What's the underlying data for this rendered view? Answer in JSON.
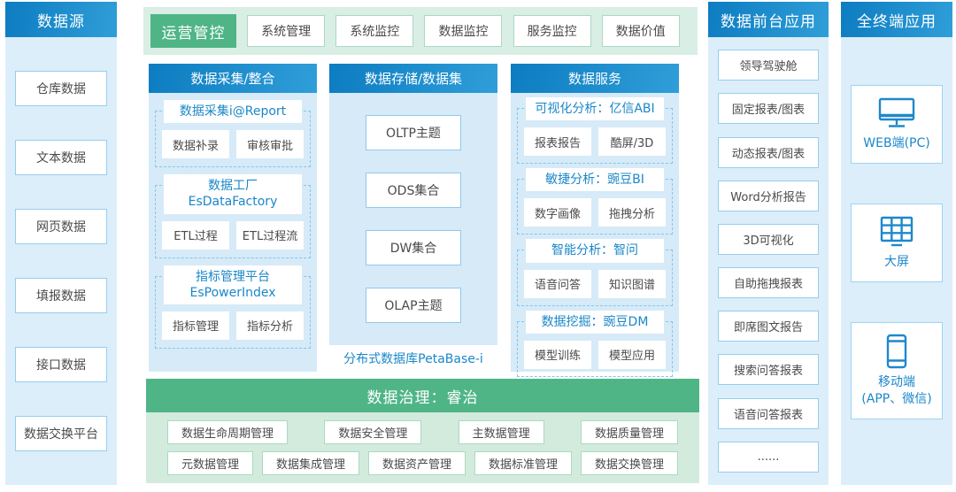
{
  "colors": {
    "header_blue_dark": "#0d7cc1",
    "header_blue_light": "#2f9ed8",
    "panel_blue": "#dceefa",
    "column_blue": "#d6eaf8",
    "box_border_blue": "#94ceef",
    "blue_text": "#1a87c9",
    "green": "#4fb586",
    "ops_bar_green": "#d9eee4",
    "gov_body_green": "#d2ebdd",
    "green_border": "#abd9c2",
    "text_gray": "#4a4a4a",
    "dashed_border": "#86c6ec"
  },
  "data_sources": {
    "title": "数据源",
    "items": [
      "仓库数据",
      "文本数据",
      "网页数据",
      "填报数据",
      "接口数据",
      "数据交换平台"
    ]
  },
  "ops": {
    "primary": "运营管控",
    "items": [
      "系统管理",
      "系统监控",
      "数据监控",
      "服务监控",
      "数据价值"
    ]
  },
  "col_collect": {
    "title": "数据采集/整合",
    "groups": [
      {
        "line1": "数据采集i@Report",
        "line2": "",
        "items": [
          "数据补录",
          "审核审批"
        ]
      },
      {
        "line1": "数据工厂",
        "line2": "EsDataFactory",
        "items": [
          "ETL过程",
          "ETL过程流"
        ]
      },
      {
        "line1": "指标管理平台",
        "line2": "EsPowerIndex",
        "items": [
          "指标管理",
          "指标分析"
        ]
      }
    ]
  },
  "col_storage": {
    "title": "数据存储/数据集",
    "items": [
      "OLTP主题",
      "ODS集合",
      "DW集合",
      "OLAP主题"
    ],
    "footer": "分布式数据库PetaBase-i"
  },
  "col_service": {
    "title": "数据服务",
    "groups": [
      {
        "line1": "可视化分析：亿信ABI",
        "line2": "",
        "items": [
          "报表报告",
          "酷屏/3D"
        ]
      },
      {
        "line1": "敏捷分析：豌豆BI",
        "line2": "",
        "items": [
          "数字画像",
          "拖拽分析"
        ]
      },
      {
        "line1": "智能分析：智问",
        "line2": "",
        "items": [
          "语音问答",
          "知识图谱"
        ]
      },
      {
        "line1": "数据挖掘：豌豆DM",
        "line2": "",
        "items": [
          "模型训练",
          "模型应用"
        ]
      }
    ]
  },
  "governance": {
    "title": "数据治理：睿治",
    "row1": [
      "数据生命周期管理",
      "数据安全管理",
      "主数据管理",
      "数据质量管理"
    ],
    "row2": [
      "元数据管理",
      "数据集成管理",
      "数据资产管理",
      "数据标准管理",
      "数据交换管理"
    ]
  },
  "frontend": {
    "title": "数据前台应用",
    "items": [
      "领导驾驶舱",
      "固定报表/图表",
      "动态报表/图表",
      "Word分析报告",
      "3D可视化",
      "自助拖拽报表",
      "即席图文报告",
      "搜索问答报表",
      "语音问答报表",
      "......"
    ]
  },
  "terminals": {
    "title": "全终端应用",
    "items": [
      {
        "icon": "monitor-icon",
        "label": "WEB端(PC)",
        "label2": ""
      },
      {
        "icon": "grid-screen-icon",
        "label": "大屏",
        "label2": ""
      },
      {
        "icon": "smartphone-icon",
        "label": "移动端",
        "label2": "(APP、微信)"
      }
    ]
  }
}
